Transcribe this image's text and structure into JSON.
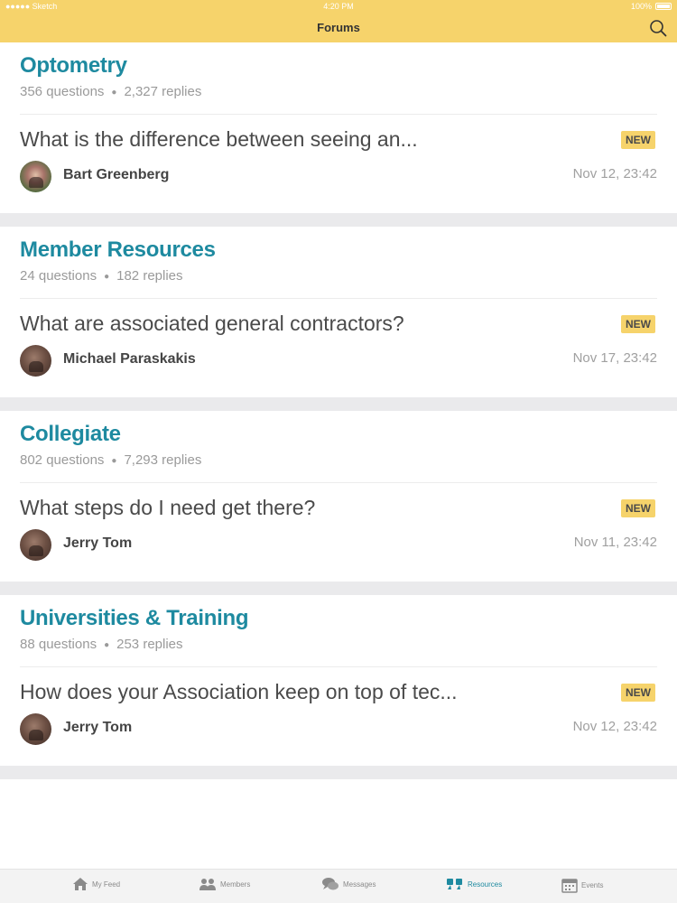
{
  "status_bar": {
    "carrier": "●●●●● Sketch",
    "time": "4:20 PM",
    "battery": "100%"
  },
  "nav": {
    "title": "Forums",
    "search_icon": "search-icon"
  },
  "forums": [
    {
      "title": "Optometry",
      "questions": "356 questions",
      "replies": "2,327 replies",
      "thread": {
        "question": "What is the difference between seeing an...",
        "badge": "NEW",
        "author": "Bart Greenberg",
        "time": "Nov 12, 23:42"
      }
    },
    {
      "title": "Member Resources",
      "questions": "24 questions",
      "replies": "182 replies",
      "thread": {
        "question": "What are associated general contractors?",
        "badge": "NEW",
        "author": "Michael Paraskakis",
        "time": "Nov 17, 23:42"
      }
    },
    {
      "title": "Collegiate",
      "questions": "802 questions",
      "replies": "7,293 replies",
      "thread": {
        "question": "What steps do I need get there?",
        "badge": "NEW",
        "author": "Jerry Tom",
        "time": "Nov 11, 23:42"
      }
    },
    {
      "title": "Universities & Training",
      "questions": "88 questions",
      "replies": "253 replies",
      "thread": {
        "question": "How does your Association keep on top of tec...",
        "badge": "NEW",
        "author": "Jerry Tom",
        "time": "Nov 12, 23:42"
      }
    }
  ],
  "tabs": [
    {
      "label": "My Feed",
      "icon": "home-icon"
    },
    {
      "label": "Members",
      "icon": "members-icon"
    },
    {
      "label": "Messages",
      "icon": "messages-icon"
    },
    {
      "label": "Resources",
      "icon": "quote-icon",
      "active": true
    },
    {
      "label": "Events",
      "icon": "calendar-icon"
    }
  ],
  "colors": {
    "accent": "#f6d36b",
    "title": "#1e8aa0",
    "tab_active": "#1e8aa0"
  }
}
